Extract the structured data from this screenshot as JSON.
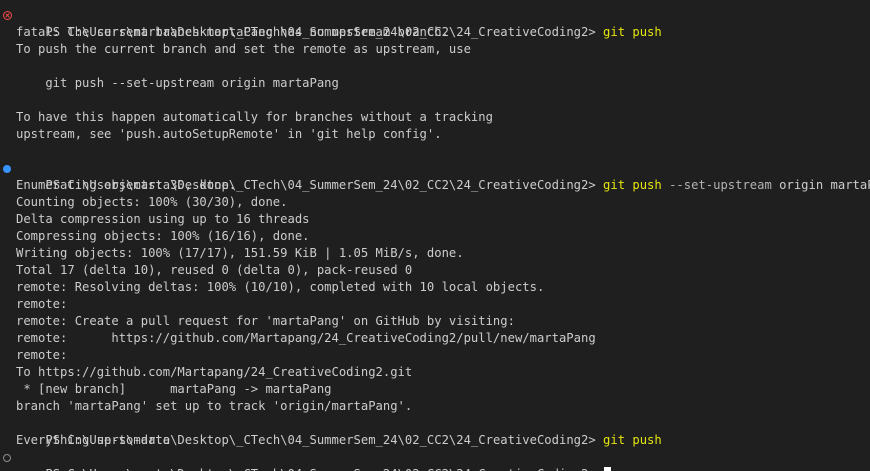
{
  "prompt": "PS C:\\Users\\marta\\Desktop\\_CTech\\04_SummerSem_24\\02_CC2\\24_CreativeCoding2> ",
  "colors": {
    "background": "#1f1f1f",
    "text": "#cccccc",
    "command": "#e5e510",
    "error_marker": "#f14c4c",
    "success_marker": "#3794ff"
  },
  "block1": {
    "command": "git push",
    "output": [
      "fatal: The current branch martaPang has no upstream branch.",
      "To push the current branch and set the remote as upstream, use",
      "",
      "    git push --set-upstream origin martaPang",
      "",
      "To have this happen automatically for branches without a tracking",
      "upstream, see 'push.autoSetupRemote' in 'git help config'."
    ]
  },
  "block2": {
    "command_git": "git",
    "command_push": "push",
    "flag": "--set-upstream",
    "remote": "origin",
    "branch": "martaPang",
    "output": [
      "Enumerating objects: 30, done.",
      "Counting objects: 100% (30/30), done.",
      "Delta compression using up to 16 threads",
      "Compressing objects: 100% (16/16), done.",
      "Writing objects: 100% (17/17), 151.59 KiB | 1.05 MiB/s, done.",
      "Total 17 (delta 10), reused 0 (delta 0), pack-reused 0",
      "remote: Resolving deltas: 100% (10/10), completed with 10 local objects.",
      "remote:",
      "remote: Create a pull request for 'martaPang' on GitHub by visiting:",
      "remote:      https://github.com/Martapang/24_CreativeCoding2/pull/new/martaPang",
      "remote:",
      "To https://github.com/Martapang/24_CreativeCoding2.git",
      " * [new branch]      martaPang -> martaPang",
      "branch 'martaPang' set up to track 'origin/martaPang'."
    ]
  },
  "block3": {
    "command": "git push",
    "output": [
      "Everything up-to-date"
    ]
  }
}
